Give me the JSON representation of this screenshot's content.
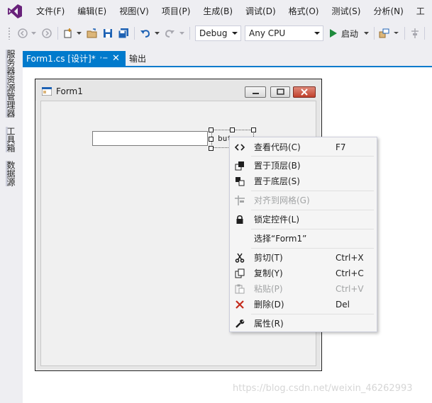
{
  "menubar": {
    "logo_icon": "visual-studio-logo-icon",
    "items": [
      {
        "label": "文件(F)"
      },
      {
        "label": "编辑(E)"
      },
      {
        "label": "视图(V)"
      },
      {
        "label": "项目(P)"
      },
      {
        "label": "生成(B)"
      },
      {
        "label": "调试(D)"
      },
      {
        "label": "格式(O)"
      },
      {
        "label": "测试(S)"
      },
      {
        "label": "分析(N)"
      },
      {
        "label": "工"
      }
    ]
  },
  "toolbar": {
    "configuration": "Debug",
    "platform": "Any CPU",
    "start_label": "启动"
  },
  "side_strip": {
    "items": [
      {
        "label": "服务器资源管理器"
      },
      {
        "label": "工具箱"
      },
      {
        "label": "数据源"
      }
    ]
  },
  "tabs": {
    "active": "Form1.cs [设计]*",
    "inactive": "输出"
  },
  "form": {
    "title": "Form1",
    "button_text": "but"
  },
  "context_menu": {
    "items": [
      {
        "label": "查看代码(C)",
        "shortcut": "F7",
        "icon": "code-icon",
        "enabled": true
      },
      {
        "label": "置于顶层(B)",
        "shortcut": "",
        "icon": "bring-to-front-icon",
        "enabled": true
      },
      {
        "label": "置于底层(S)",
        "shortcut": "",
        "icon": "send-to-back-icon",
        "enabled": true
      },
      {
        "label": "对齐到网格(G)",
        "shortcut": "",
        "icon": "align-to-grid-icon",
        "enabled": false
      },
      {
        "label": "锁定控件(L)",
        "shortcut": "",
        "icon": "lock-icon",
        "enabled": true
      },
      {
        "label": "选择“Form1”",
        "shortcut": "",
        "icon": "",
        "enabled": true
      },
      {
        "label": "剪切(T)",
        "shortcut": "Ctrl+X",
        "icon": "cut-icon",
        "enabled": true
      },
      {
        "label": "复制(Y)",
        "shortcut": "Ctrl+C",
        "icon": "copy-icon",
        "enabled": true
      },
      {
        "label": "粘贴(P)",
        "shortcut": "Ctrl+V",
        "icon": "paste-icon",
        "enabled": false
      },
      {
        "label": "删除(D)",
        "shortcut": "Del",
        "icon": "delete-icon",
        "enabled": true
      },
      {
        "label": "属性(R)",
        "shortcut": "",
        "icon": "properties-wrench-icon",
        "enabled": true
      }
    ]
  },
  "watermark": "https://blog.csdn.net/weixin_46262993",
  "colors": {
    "accent": "#007acc",
    "logo": "#68217a",
    "delete_red": "#c42b1c",
    "play_green": "#1e8a3c"
  }
}
